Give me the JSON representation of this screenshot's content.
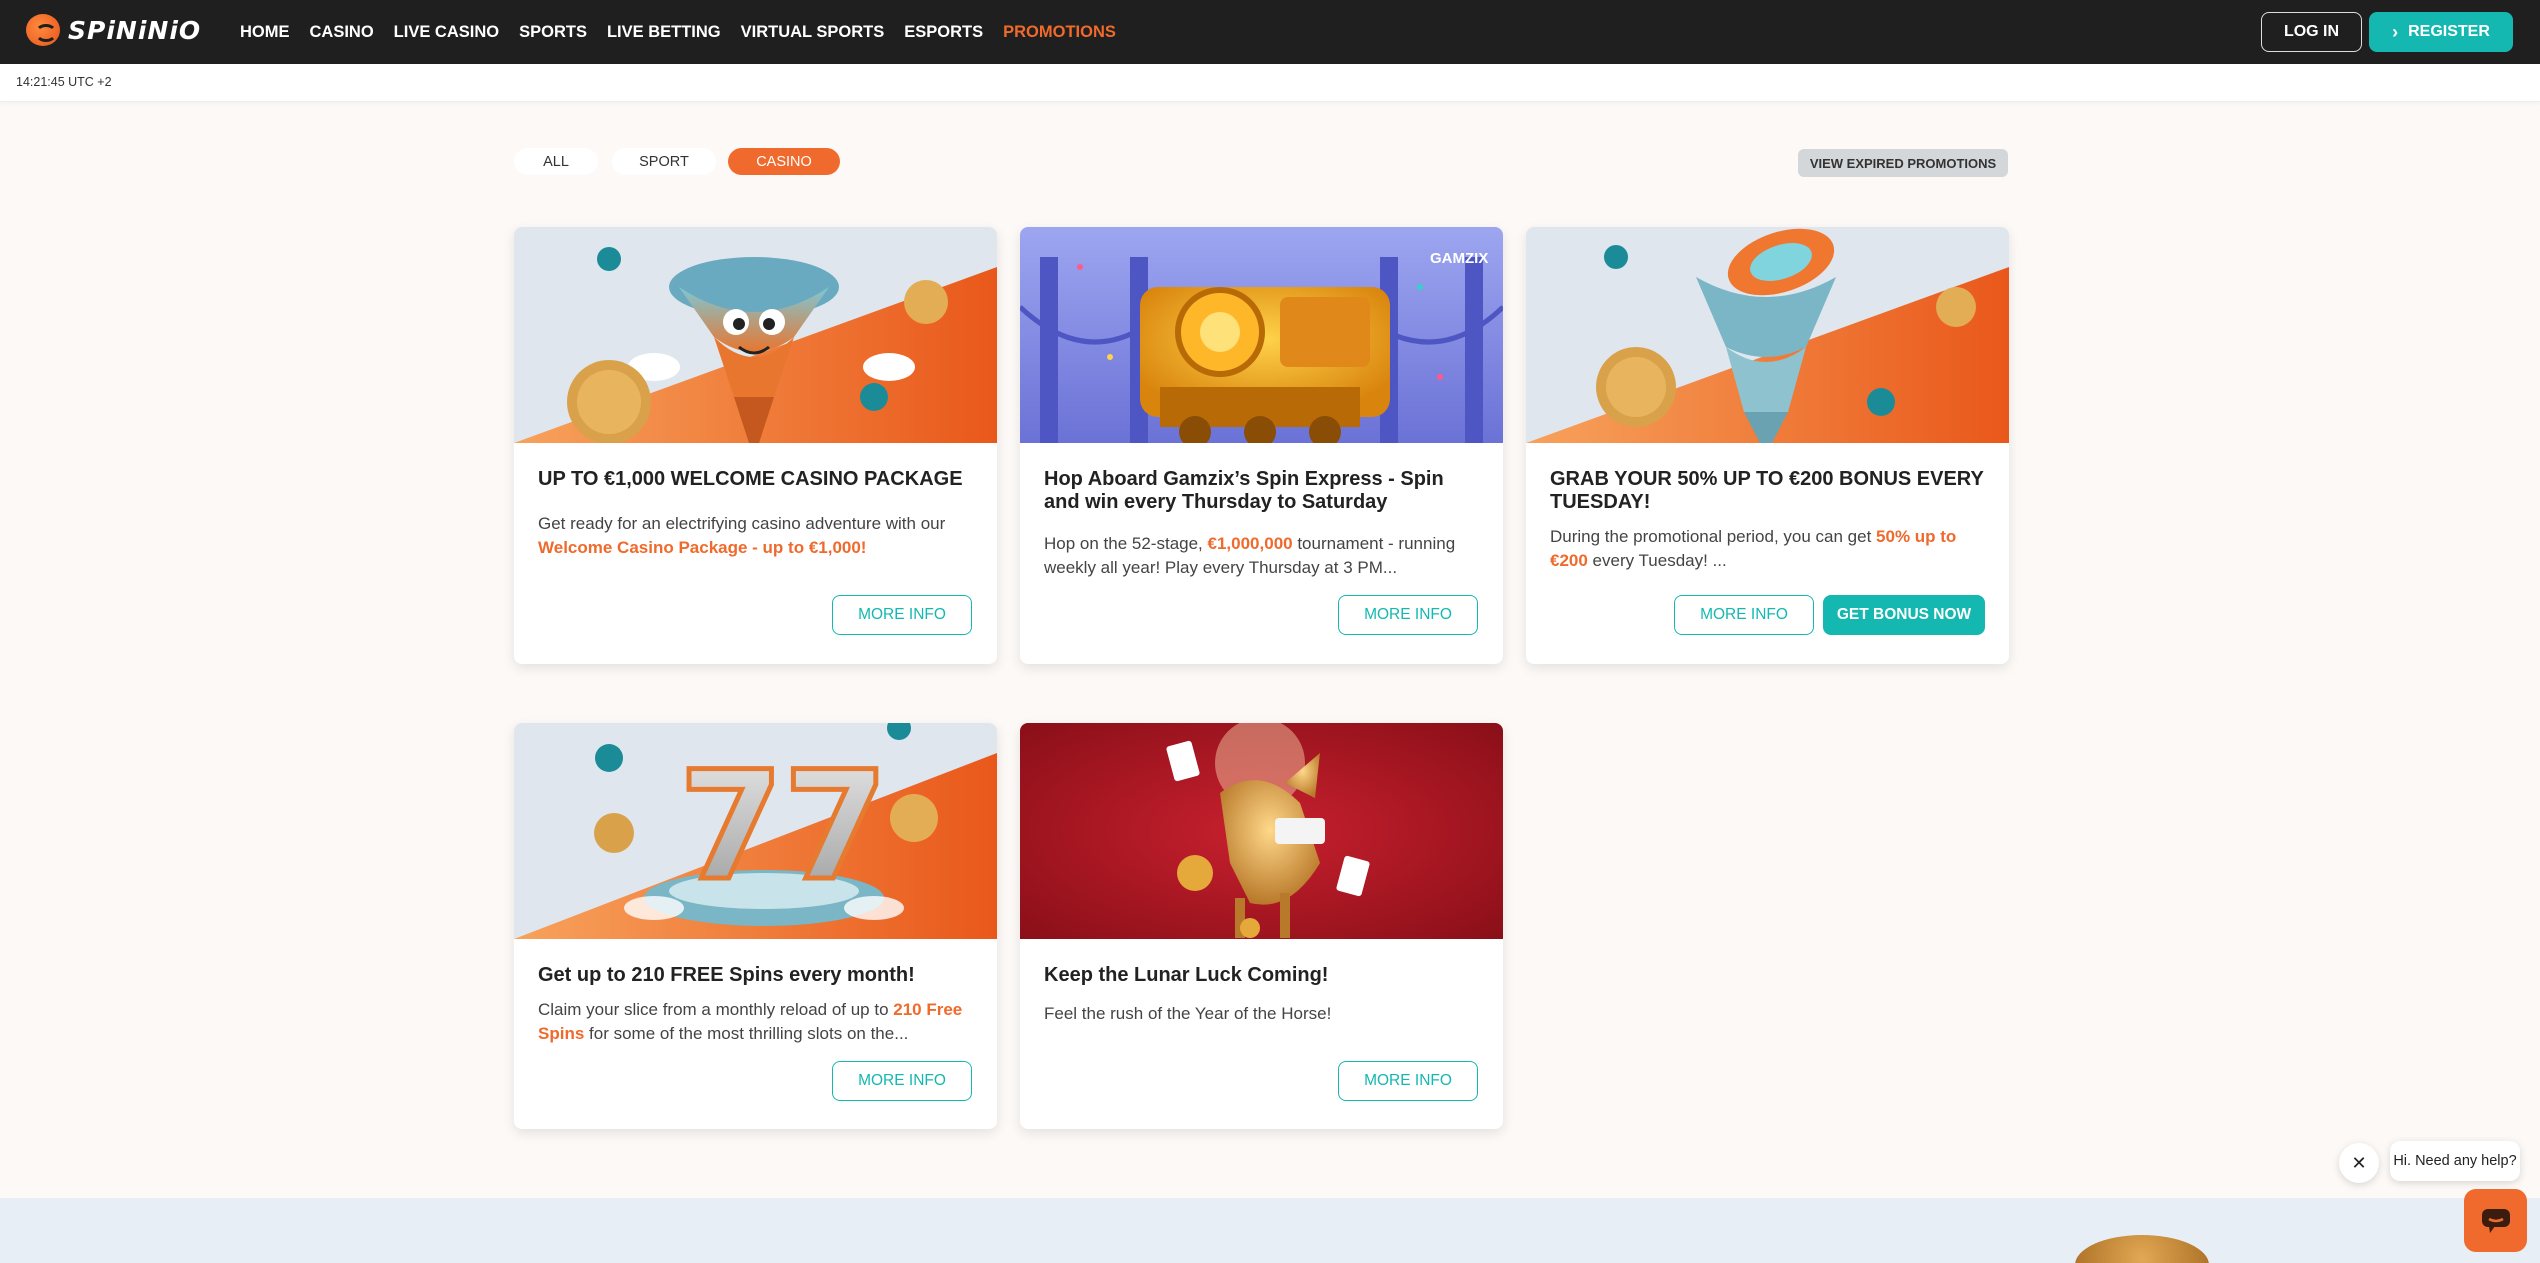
{
  "brand": {
    "logo_text": "SPiNiNiO",
    "accent": "#ef6a2c",
    "teal": "#14b8b0",
    "nav_bg": "#1f1f1f"
  },
  "nav": {
    "items": [
      {
        "label": "HOME"
      },
      {
        "label": "CASINO"
      },
      {
        "label": "LIVE CASINO"
      },
      {
        "label": "SPORTS"
      },
      {
        "label": "LIVE BETTING"
      },
      {
        "label": "VIRTUAL SPORTS"
      },
      {
        "label": "ESPORTS"
      },
      {
        "label": "PROMOTIONS",
        "active": true
      }
    ],
    "login_label": "LOG IN",
    "register_label": "REGISTER"
  },
  "clock": "14:21:45 UTC +2",
  "filters": {
    "items": [
      {
        "label": "ALL"
      },
      {
        "label": "SPORT"
      },
      {
        "label": "CASINO",
        "active": true
      }
    ],
    "expired_label": "VIEW EXPIRED PROMOTIONS"
  },
  "cards": [
    {
      "title": "UP TO €1,000 WELCOME CASINO PACKAGE",
      "desc_pre": "Get ready for an electrifying casino adventure with our ",
      "desc_hl": "Welcome Casino Package - up to €1,000!",
      "desc_post": "",
      "more_label": "MORE INFO"
    },
    {
      "title": "Hop Aboard Gamzix’s Spin Express - Spin and win every Thursday to Saturday",
      "desc_pre": "Hop on the 52-stage, ",
      "desc_hl": "€1,000,000",
      "desc_post": " tournament - running weekly all year! Play every Thursday at 3 PM...",
      "more_label": "MORE INFO",
      "image_tag": "GAMZIX"
    },
    {
      "title": "GRAB YOUR 50% UP TO €200 BONUS EVERY TUESDAY!",
      "desc_pre": "During the promotional period, you can get ",
      "desc_hl": "50% up to €200",
      "desc_post": " every Tuesday! ...",
      "more_label": "MORE INFO",
      "bonus_label": "GET BONUS NOW"
    },
    {
      "title": "Get up to 210 FREE Spins every month!",
      "desc_pre": "Claim your slice from a monthly reload of up to ",
      "desc_hl": "210 Free Spins",
      "desc_post": " for some of the most thrilling slots on the...",
      "more_label": "MORE INFO"
    },
    {
      "title": "Keep the Lunar Luck Coming!",
      "desc_pre": "Feel the rush of the Year of the Horse!",
      "desc_hl": "",
      "desc_post": "",
      "more_label": "MORE INFO"
    }
  ],
  "chat": {
    "prompt": "Hi. Need any help?"
  }
}
